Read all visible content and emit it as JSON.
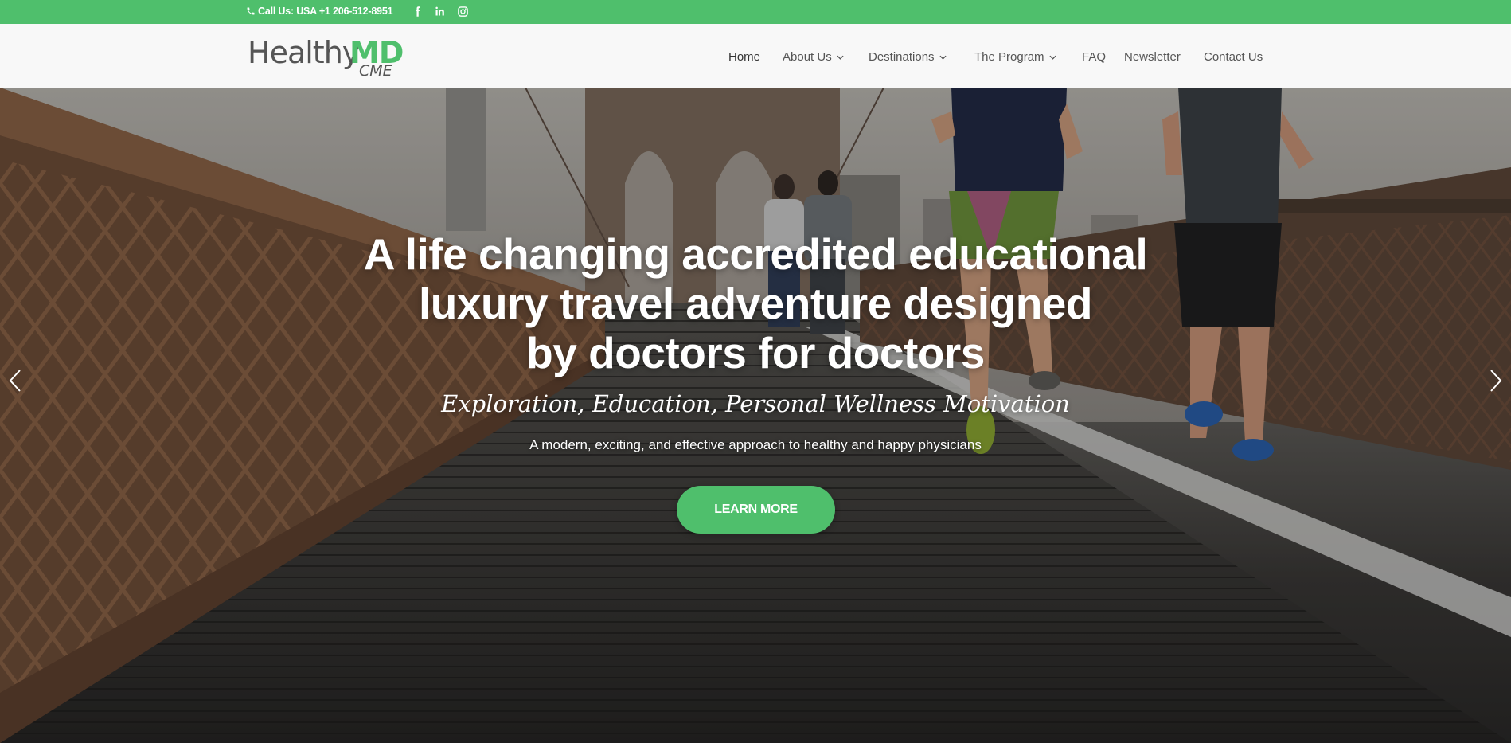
{
  "topbar": {
    "phone_label": "Call Us: USA +1 206-512-8951",
    "social": [
      {
        "name": "facebook",
        "icon": "facebook-icon"
      },
      {
        "name": "linkedin",
        "icon": "linkedin-icon"
      },
      {
        "name": "instagram",
        "icon": "instagram-icon"
      }
    ],
    "color": "#4fbf6c"
  },
  "header": {
    "logo": {
      "healthy": "Healthy",
      "md": "MD",
      "cme": "CME"
    },
    "nav": [
      {
        "label": "Home",
        "dropdown": false,
        "active": true
      },
      {
        "label": "About Us",
        "dropdown": true
      },
      {
        "label": "Destinations",
        "dropdown": true
      },
      {
        "label": "The Program",
        "dropdown": true
      },
      {
        "label": "FAQ",
        "dropdown": false
      },
      {
        "label": "Newsletter",
        "dropdown": false
      },
      {
        "label": "Contact Us",
        "dropdown": false
      }
    ]
  },
  "hero": {
    "title_lines": [
      "A life changing accredited educational",
      "luxury  travel adventure designed",
      "by doctors for doctors"
    ],
    "script": "Exploration, Education, Personal Wellness Motivation",
    "subtitle": "A modern, exciting, and effective approach to healthy and happy physicians",
    "cta_label": "LEARN MORE",
    "accent": "#4fbf6c"
  }
}
